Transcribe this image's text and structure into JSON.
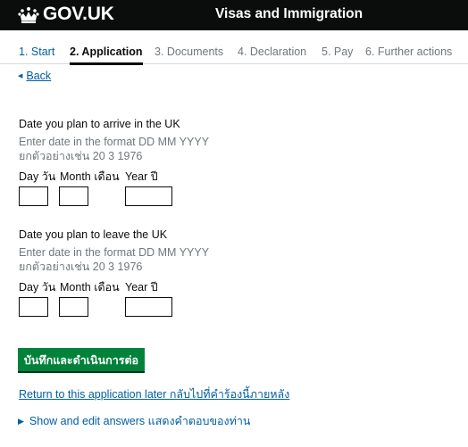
{
  "header": {
    "logo_text": "GOV.UK",
    "service_name": "Visas and Immigration",
    "background_color": "#0b0c0c"
  },
  "steps": [
    {
      "label": "1. Start",
      "state": "completed"
    },
    {
      "label": "2. Application",
      "state": "current"
    },
    {
      "label": "3. Documents",
      "state": "upcoming"
    },
    {
      "label": "4. Declaration",
      "state": "upcoming"
    },
    {
      "label": "5. Pay",
      "state": "upcoming"
    },
    {
      "label": "6. Further actions",
      "state": "upcoming"
    }
  ],
  "back_link": "Back",
  "arrive": {
    "title": "Date you plan to arrive in the UK",
    "hint": "Enter date in the format DD MM YYYY",
    "hint_thai": "ยกตัวอย่างเช่น 20 3 1976",
    "day_label": "Day วัน",
    "month_label": "Month เดือน",
    "year_label": "Year ปี",
    "day_value": "",
    "month_value": "",
    "year_value": ""
  },
  "leave": {
    "title": "Date you plan to leave the UK",
    "hint": "Enter date in the format DD MM YYYY",
    "hint_thai": "ยกตัวอย่างเช่น 20 3 1976",
    "day_label": "Day วัน",
    "month_label": "Month เดือน",
    "year_label": "Year ปี",
    "day_value": "",
    "month_value": "",
    "year_value": ""
  },
  "continue_button": "บันทึกและดำเนินการต่อ",
  "return_link": "Return to this application later กลับไปที่คำร้องนี้ภายหลัง",
  "details_summary": "Show and edit answers แสดงคำตอบของท่าน",
  "colors": {
    "link": "#005ea5",
    "button": "#00823b",
    "hint": "#6f777b",
    "text": "#0b0c0c"
  }
}
